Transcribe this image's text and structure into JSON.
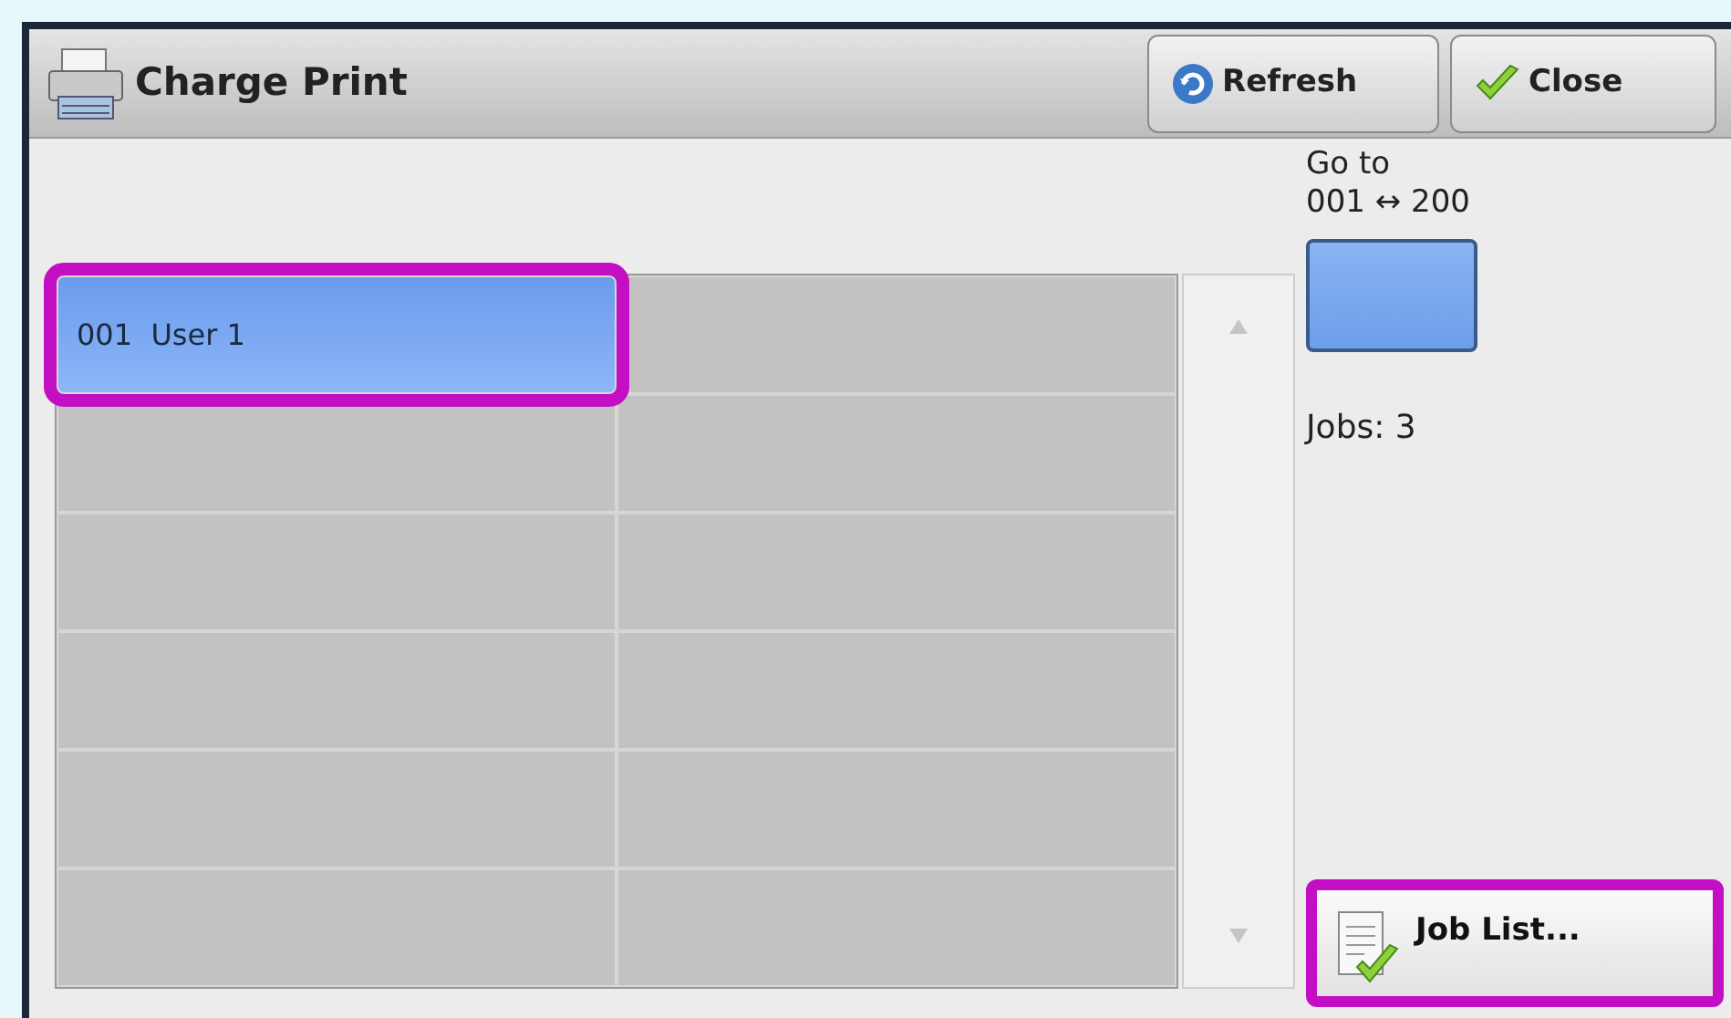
{
  "window": {
    "title": "Charge Print"
  },
  "toolbar": [
    {
      "kind": "refresh",
      "label": "Refresh"
    },
    {
      "kind": "close",
      "label": "Close"
    }
  ],
  "users": [
    {
      "label": "001  User 1",
      "selected": true,
      "highlighted": true
    },
    {
      "selected": false,
      "highlighted": false
    },
    {
      "selected": false,
      "highlighted": false
    },
    {
      "selected": false,
      "highlighted": false
    },
    {
      "selected": false,
      "highlighted": false
    },
    {
      "selected": false,
      "highlighted": false
    },
    {
      "selected": false,
      "highlighted": false
    },
    {
      "selected": false,
      "highlighted": false
    },
    {
      "selected": false,
      "highlighted": false
    },
    {
      "selected": false,
      "highlighted": false
    },
    {
      "selected": false,
      "highlighted": false
    },
    {
      "selected": false,
      "highlighted": false
    }
  ],
  "go_to": {
    "label": "Go to",
    "range": "001 ↔ 200"
  },
  "jobs": "Jobs: 3",
  "job_list_button": {
    "label": "Job List...",
    "highlighted": true
  }
}
